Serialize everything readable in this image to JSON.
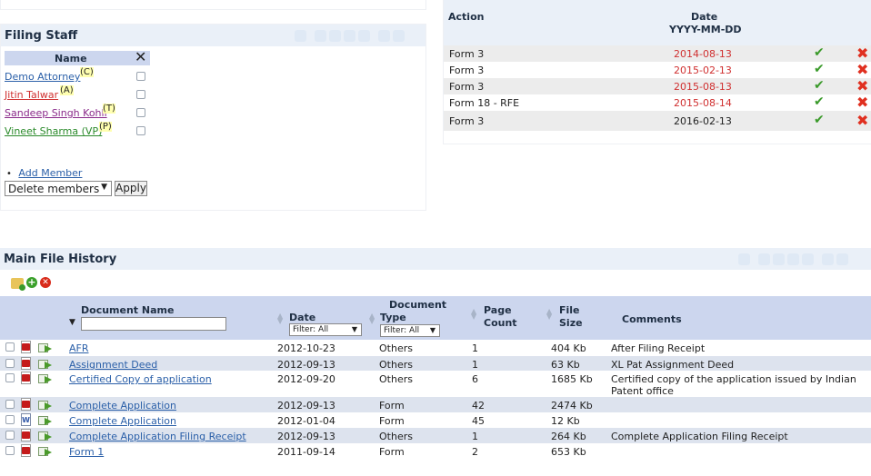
{
  "filing_staff": {
    "title": "Filing Staff",
    "column_name": "Name",
    "members": [
      {
        "name": "Demo Attorney",
        "role": "(C)",
        "color": "#2a5fa8"
      },
      {
        "name": "Jitin Talwar",
        "role": "(A)",
        "color": "#d03030"
      },
      {
        "name": "Sandeep Singh Kohli",
        "role": "(T)",
        "color": "#8a2a8a"
      },
      {
        "name": "Vineet Sharma (VP)",
        "role": "(P)",
        "color": "#2a8a2a"
      }
    ],
    "add_member_label": "Add Member",
    "action_select_value": "Delete members",
    "apply_label": "Apply"
  },
  "actions_table": {
    "col_action": "Action",
    "col_date": "Date",
    "col_date_format": "YYYY-MM-DD",
    "rows": [
      {
        "action": "Form 3",
        "date": "2014-08-13",
        "date_color": "#d03030"
      },
      {
        "action": "Form 3",
        "date": "2015-02-13",
        "date_color": "#d03030"
      },
      {
        "action": "Form 3",
        "date": "2015-08-13",
        "date_color": "#d03030"
      },
      {
        "action": "Form 18 - RFE",
        "date": "2015-08-14",
        "date_color": "#d03030"
      },
      {
        "action": "Form 3",
        "date": "2016-02-13",
        "date_color": "#222222"
      }
    ],
    "check_glyph": "✔",
    "x_glyph": "✖"
  },
  "history": {
    "title": "Main File History",
    "columns": {
      "doc_name": "Document Name",
      "date": "Date",
      "date_filter": "Filter: All",
      "doc_type_1": "Document",
      "doc_type_2": "Type",
      "type_filter": "Filter: All",
      "page_1": "Page",
      "page_2": "Count",
      "file_1": "File",
      "file_2": "Size",
      "comments": "Comments"
    },
    "rows": [
      {
        "name": "AFR",
        "date": "2012-10-23",
        "type": "Others",
        "pages": "1",
        "size": "404 Kb",
        "comment": "After Filing Receipt",
        "comment2": "",
        "icon": "pdf"
      },
      {
        "name": "Assignment Deed",
        "date": "2012-09-13",
        "type": "Others",
        "pages": "1",
        "size": "63 Kb",
        "comment": "XL Pat Assignment Deed",
        "comment2": "",
        "icon": "pdf"
      },
      {
        "name": "Certified Copy of application",
        "date": "2012-09-20",
        "type": "Others",
        "pages": "6",
        "size": "1685 Kb",
        "comment": "Certified copy of the application issued by Indian",
        "comment2": "Patent office",
        "icon": "pdf"
      },
      {
        "name": "Complete Application",
        "date": "2012-09-13",
        "type": "Form",
        "pages": "42",
        "size": "2474 Kb",
        "comment": "",
        "comment2": "",
        "icon": "pdf"
      },
      {
        "name": "Complete Application",
        "date": "2012-01-04",
        "type": "Form",
        "pages": "45",
        "size": "12 Kb",
        "comment": "",
        "comment2": "",
        "icon": "doc"
      },
      {
        "name": "Complete Application Filing Receipt",
        "date": "2012-09-13",
        "type": "Others",
        "pages": "1",
        "size": "264 Kb",
        "comment": "Complete Application Filing Receipt",
        "comment2": "",
        "icon": "pdf"
      },
      {
        "name": "Form 1",
        "date": "2011-09-14",
        "type": "Form",
        "pages": "2",
        "size": "653 Kb",
        "comment": "",
        "comment2": "",
        "icon": "pdf"
      }
    ]
  }
}
